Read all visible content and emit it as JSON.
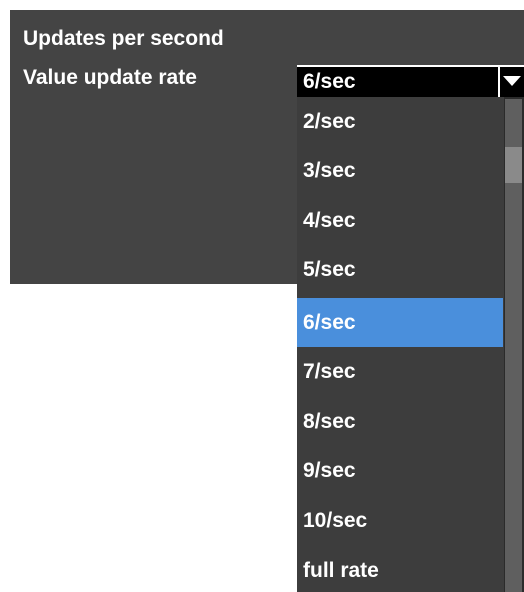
{
  "settings": {
    "section_title": "Updates per second",
    "field_label": "Value update rate",
    "selected_value": "6/sec"
  },
  "dropdown": {
    "options": [
      "2/sec",
      "3/sec",
      "4/sec",
      "5/sec",
      "6/sec",
      "7/sec",
      "8/sec",
      "9/sec",
      "10/sec",
      "full rate"
    ],
    "selected_index": 4
  },
  "colors": {
    "panel_bg": "#444444",
    "selected_bg": "#4a8fdc",
    "dropdown_bg": "#3d3d3d",
    "text": "#ffffff"
  },
  "icons": {
    "dropdown_toggle": "triangle-down-icon"
  }
}
